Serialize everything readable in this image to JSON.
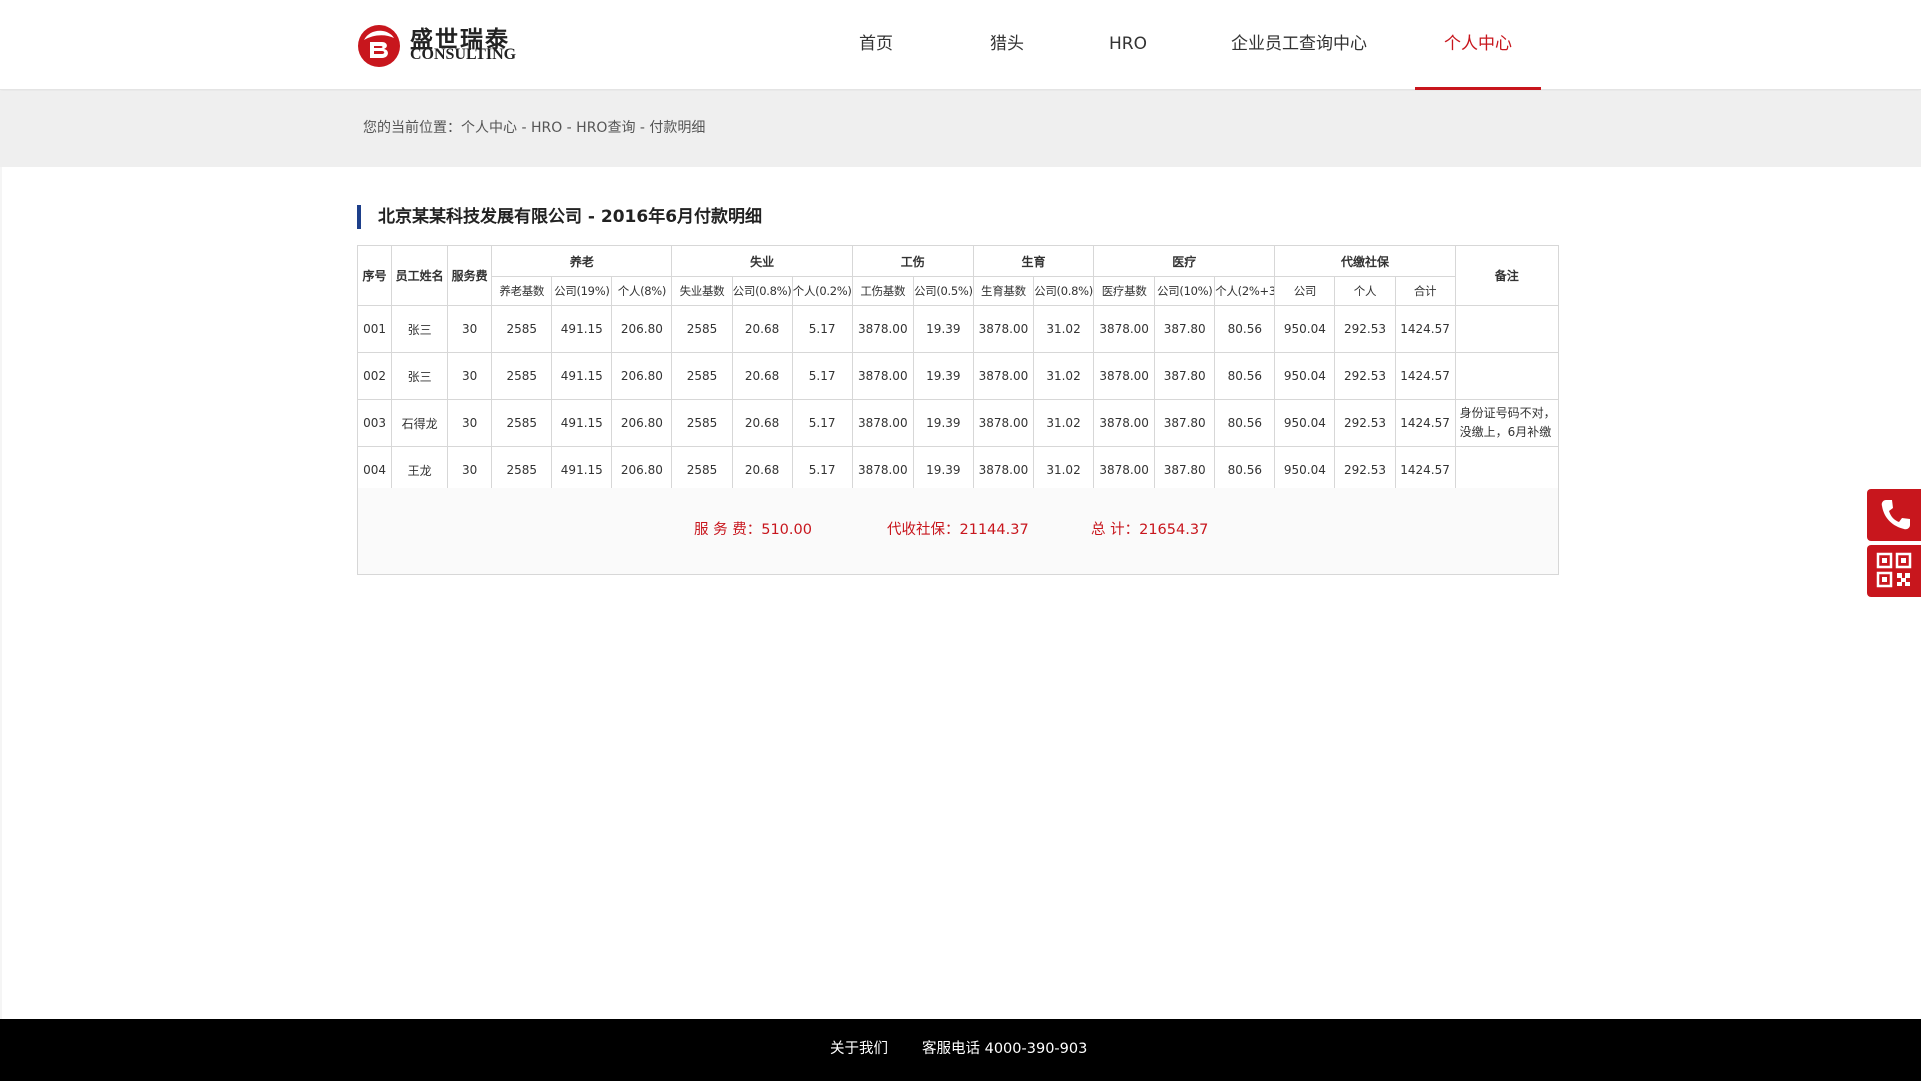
{
  "brand": {
    "name_cn": "盛世瑞泰",
    "name_en": "CONSULTING",
    "accent": "#c8161d"
  },
  "nav": {
    "items": [
      {
        "label": "首页"
      },
      {
        "label": "猎头"
      },
      {
        "label": "HRO"
      },
      {
        "label": "企业员工查询中心"
      },
      {
        "label": "个人中心",
        "active": true
      }
    ]
  },
  "breadcrumb": "您的当前位置：个人中心 - HRO - HRO查询 - 付款明细",
  "page_title": "北京某某科技发展有限公司 - 2016年6月付款明细",
  "table": {
    "fixed_headers": [
      "序号",
      "员工姓名",
      "服务费"
    ],
    "groups": [
      {
        "label": "养老",
        "subs": [
          "养老基数",
          "公司(19%)",
          "个人(8%)"
        ]
      },
      {
        "label": "失业",
        "subs": [
          "失业基数",
          "公司(0.8%)",
          "个人(0.2%)"
        ]
      },
      {
        "label": "工伤",
        "subs": [
          "工伤基数",
          "公司(0.5%)"
        ]
      },
      {
        "label": "生育",
        "subs": [
          "生育基数",
          "公司(0.8%)"
        ]
      },
      {
        "label": "医疗",
        "subs": [
          "医疗基数",
          "公司(10%)",
          "个人(2%+3)"
        ]
      },
      {
        "label": "代缴社保",
        "subs": [
          "公司",
          "个人",
          "合计"
        ]
      }
    ],
    "remark_header": "备注",
    "rows": [
      {
        "cells": [
          "001",
          "张三",
          "30",
          "2585",
          "491.15",
          "206.80",
          "2585",
          "20.68",
          "5.17",
          "3878.00",
          "19.39",
          "3878.00",
          "31.02",
          "3878.00",
          "387.80",
          "80.56",
          "950.04",
          "292.53",
          "1424.57"
        ],
        "remark": ""
      },
      {
        "cells": [
          "002",
          "张三",
          "30",
          "2585",
          "491.15",
          "206.80",
          "2585",
          "20.68",
          "5.17",
          "3878.00",
          "19.39",
          "3878.00",
          "31.02",
          "3878.00",
          "387.80",
          "80.56",
          "950.04",
          "292.53",
          "1424.57"
        ],
        "remark": ""
      },
      {
        "cells": [
          "003",
          "石得龙",
          "30",
          "2585",
          "491.15",
          "206.80",
          "2585",
          "20.68",
          "5.17",
          "3878.00",
          "19.39",
          "3878.00",
          "31.02",
          "3878.00",
          "387.80",
          "80.56",
          "950.04",
          "292.53",
          "1424.57"
        ],
        "remark": "身份证号码不对，没缴上，6月补缴"
      },
      {
        "cells": [
          "004",
          "王龙",
          "30",
          "2585",
          "491.15",
          "206.80",
          "2585",
          "20.68",
          "5.17",
          "3878.00",
          "19.39",
          "3878.00",
          "31.02",
          "3878.00",
          "387.80",
          "80.56",
          "950.04",
          "292.53",
          "1424.57"
        ],
        "remark": ""
      }
    ]
  },
  "summary": {
    "service_fee": "服  务  费：510.00",
    "social_security": "代收社保：21144.37",
    "total": "总        计：21654.37"
  },
  "footer": {
    "about": "关于我们",
    "hotline": "客服电话  4000-390-903"
  },
  "side_buttons": [
    {
      "icon": "phone-icon"
    },
    {
      "icon": "qr-code-icon"
    }
  ]
}
